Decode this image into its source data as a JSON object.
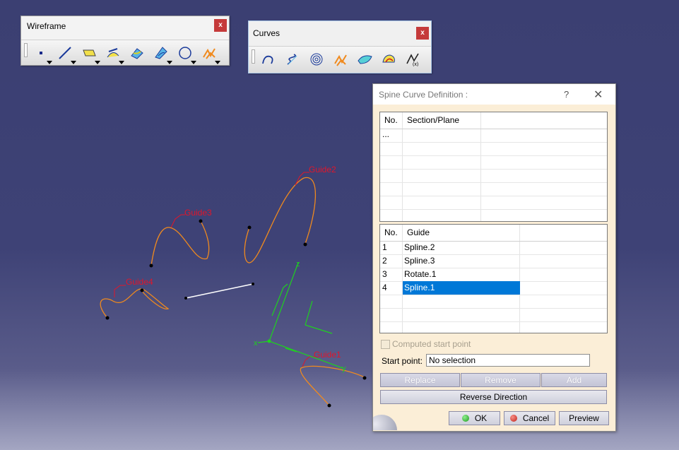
{
  "toolbars": {
    "wireframe": {
      "title": "Wireframe",
      "close": "x",
      "icons": [
        "point-icon",
        "line-icon",
        "plane-icon",
        "projection-icon",
        "intersection-icon",
        "offset-icon",
        "circle-icon",
        "spline-icon"
      ]
    },
    "curves": {
      "title": "Curves",
      "close": "x",
      "icons": [
        "connect-curve-icon",
        "helix-icon",
        "spiral-icon",
        "spine-icon",
        "isoparametric-curve-icon",
        "curve-on-surface-icon",
        "law-icon"
      ]
    }
  },
  "viewport": {
    "labels": {
      "guide1": "Guide1",
      "guide2": "Guide2",
      "guide3": "Guide3",
      "guide4": "Guide4"
    },
    "axes": {
      "x": "x",
      "y": "y",
      "z": "z"
    },
    "colors": {
      "curve": "#f08a1e",
      "label": "#e0162b",
      "axis": "#1fd11f",
      "background": "#3d4174"
    }
  },
  "dialog": {
    "title": "Spine Curve Definition :",
    "help": "?",
    "close": "✕",
    "section_table": {
      "headers": [
        "No.",
        "Section/Plane"
      ],
      "rows": [
        [
          "...",
          ""
        ]
      ]
    },
    "guide_table": {
      "headers": [
        "No.",
        "Guide"
      ],
      "rows": [
        {
          "no": "1",
          "name": "Spline.2",
          "selected": false
        },
        {
          "no": "2",
          "name": "Spline.3",
          "selected": false
        },
        {
          "no": "3",
          "name": "Rotate.1",
          "selected": false
        },
        {
          "no": "4",
          "name": "Spline.1",
          "selected": true
        }
      ]
    },
    "computed_start_point": {
      "label": "Computed start point",
      "checked": false,
      "enabled": false
    },
    "start_point": {
      "label": "Start point:",
      "value": "No selection"
    },
    "buttons": {
      "replace": "Replace",
      "remove": "Remove",
      "add": "Add",
      "reverse_direction": "Reverse Direction",
      "ok": "OK",
      "cancel": "Cancel",
      "preview": "Preview"
    },
    "colors": {
      "background": "#fbeed7",
      "selection": "#0078d7",
      "ok_led": "#29b629",
      "cancel_led": "#d42a1f"
    }
  }
}
